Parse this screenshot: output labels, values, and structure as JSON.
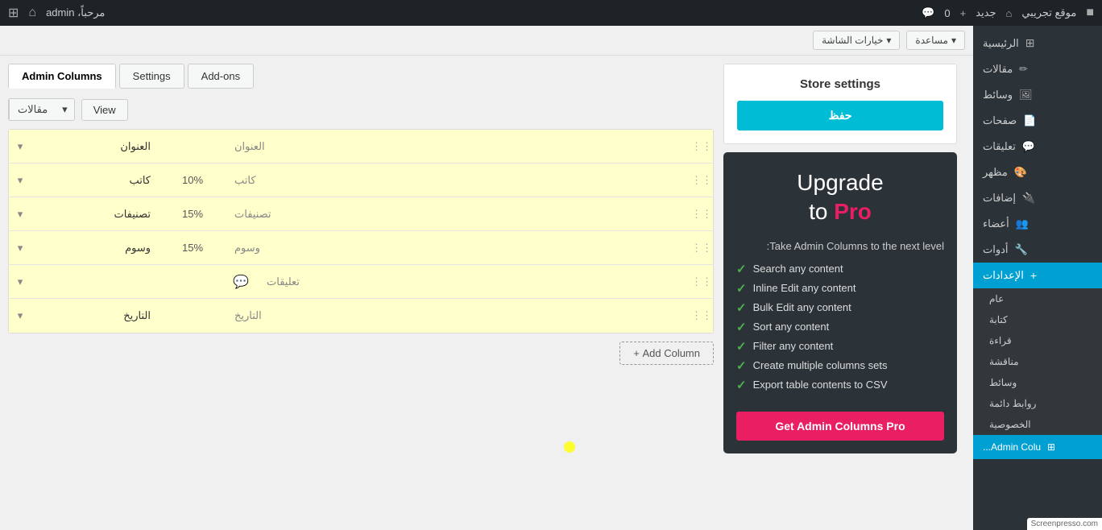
{
  "admin_bar": {
    "wp_icon": "⊞",
    "site_name": "موقع تجريبي",
    "home_icon": "⌂",
    "username": "مرحباً، admin",
    "new_label": "جديد",
    "notif_count": "0",
    "comment_icon": "💬",
    "update_icon": "⟳"
  },
  "secondary_bar": {
    "screen_options": "خيارات الشاشة",
    "help": "مساعدة",
    "arrow": "▾"
  },
  "tabs": {
    "addons": "Add-ons",
    "settings": "Settings",
    "admin_columns": "Admin Columns"
  },
  "column_selector": {
    "label": "مقالات",
    "arrow": "▾",
    "view": "View"
  },
  "columns": [
    {
      "name_ar": "العنوان",
      "label_ar": "العنوان",
      "width": "",
      "icon": ""
    },
    {
      "name_ar": "كاتب",
      "label_ar": "كاتب",
      "width": "10%",
      "icon": ""
    },
    {
      "name_ar": "تصنيفات",
      "label_ar": "تصنيفات",
      "width": "15%",
      "icon": ""
    },
    {
      "name_ar": "وسوم",
      "label_ar": "وسوم",
      "width": "15%",
      "icon": ""
    },
    {
      "name_ar": "تعليقات",
      "label_ar": "",
      "width": "",
      "icon": "💬"
    },
    {
      "name_ar": "التاريخ",
      "label_ar": "التاريخ",
      "width": "",
      "icon": ""
    }
  ],
  "add_column_btn": "Add Column +",
  "store_settings": {
    "title": "Store settings",
    "save": "حفظ"
  },
  "upgrade": {
    "title_line1": "Upgrade",
    "title_to": "to",
    "title_pro": "Pro",
    "subtitle": "Take Admin Columns to the next level:",
    "features": [
      "Search any content",
      "Inline Edit any content",
      "Bulk Edit any content",
      "Sort any content",
      "Filter any content",
      "Create multiple columns sets",
      "Export table contents to CSV"
    ],
    "cta": "Get Admin Columns Pro"
  },
  "sidebar": {
    "items": [
      {
        "label": "الرئيسية",
        "icon": "⊞"
      },
      {
        "label": "مقالات",
        "icon": "📝"
      },
      {
        "label": "وسائط",
        "icon": "🖼"
      },
      {
        "label": "صفحات",
        "icon": "📄"
      },
      {
        "label": "تعليقات",
        "icon": "💬"
      },
      {
        "label": "مظهر",
        "icon": "🎨"
      },
      {
        "label": "إضافات",
        "icon": "🔌"
      },
      {
        "label": "أعضاء",
        "icon": "👥"
      },
      {
        "label": "أدوات",
        "icon": "🔧"
      },
      {
        "label": "الإعدادات",
        "icon": "+"
      }
    ],
    "submenu": [
      {
        "label": "عام"
      },
      {
        "label": "كتابة"
      },
      {
        "label": "قراءة"
      },
      {
        "label": "مناقشة"
      },
      {
        "label": "وسائط"
      },
      {
        "label": "روابط دائمة"
      },
      {
        "label": "الخصوصية"
      }
    ],
    "admin_col_label": "Admin Colu..."
  }
}
